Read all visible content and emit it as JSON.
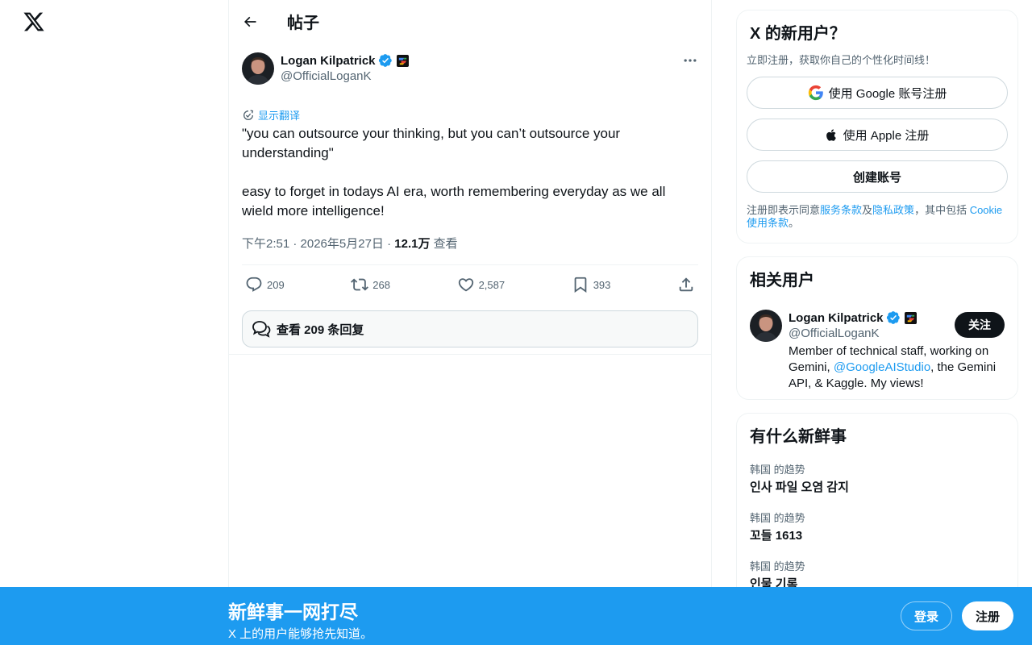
{
  "header": {
    "title": "帖子"
  },
  "tweet": {
    "author_name": "Logan Kilpatrick",
    "author_handle": "@OfficialLoganK",
    "translate_label": "显示翻译",
    "text": "\"you can outsource your thinking, but you can’t outsource your understanding\"\n\neasy to forget in todays AI era, worth remembering everyday as we all wield more intelligence!",
    "timestamp": "下午2:51 · 2026年5月27日",
    "separator": " · ",
    "views_count": "12.1万",
    "views_label": " 查看",
    "replies": "209",
    "reposts": "268",
    "likes": "2,587",
    "bookmarks": "393",
    "view_replies_label": "查看 209 条回复"
  },
  "signup": {
    "title": "X 的新用户？",
    "subtitle": "立即注册，获取你自己的个性化时间线！",
    "google_label": "使用 Google 账号注册",
    "apple_label": "使用 Apple 注册",
    "create_label": "创建账号",
    "terms_prefix": "注册即表示同意",
    "terms_link": "服务条款",
    "terms_and": "及",
    "privacy_link": "隐私政策",
    "terms_mid": "，其中包括 ",
    "cookie_link": "Cookie 使用条款",
    "terms_end": "。"
  },
  "related": {
    "title": "相关用户",
    "user_name": "Logan Kilpatrick",
    "user_handle": "@OfficialLoganK",
    "follow_label": "关注",
    "bio_prefix": "Member of technical staff, working on Gemini, ",
    "bio_link": "@GoogleAIStudio",
    "bio_suffix": ", the Gemini API, & Kaggle. My views!"
  },
  "trends": {
    "title": "有什么新鲜事",
    "items": [
      {
        "context": "韩国 的趋势",
        "name": "인사 파일 오염 감지"
      },
      {
        "context": "韩国 的趋势",
        "name": "꼬들 1613"
      },
      {
        "context": "韩国 的趋势",
        "name": "인물 기록"
      }
    ]
  },
  "bottom_bar": {
    "title": "新鲜事一网打尽",
    "subtitle": "X 上的用户能够抢先知道。",
    "login_label": "登录",
    "signup_label": "注册"
  },
  "colors": {
    "accent": "#1d9bf0",
    "text": "#0f1419",
    "muted": "#536471"
  }
}
